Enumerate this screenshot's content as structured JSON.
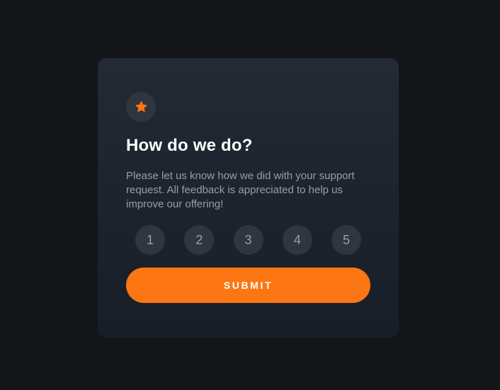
{
  "card": {
    "icon": "star-icon",
    "title": "How do we do?",
    "description": "Please let us know how we did with your support request. All feedback is appreciated to help us improve our offering!",
    "ratings": [
      "1",
      "2",
      "3",
      "4",
      "5"
    ],
    "submit_label": "SUBMIT"
  },
  "colors": {
    "background": "#131518",
    "card": "#232a34",
    "accent": "#fc7614",
    "muted_text": "#959eac",
    "circle": "#2f3640"
  }
}
